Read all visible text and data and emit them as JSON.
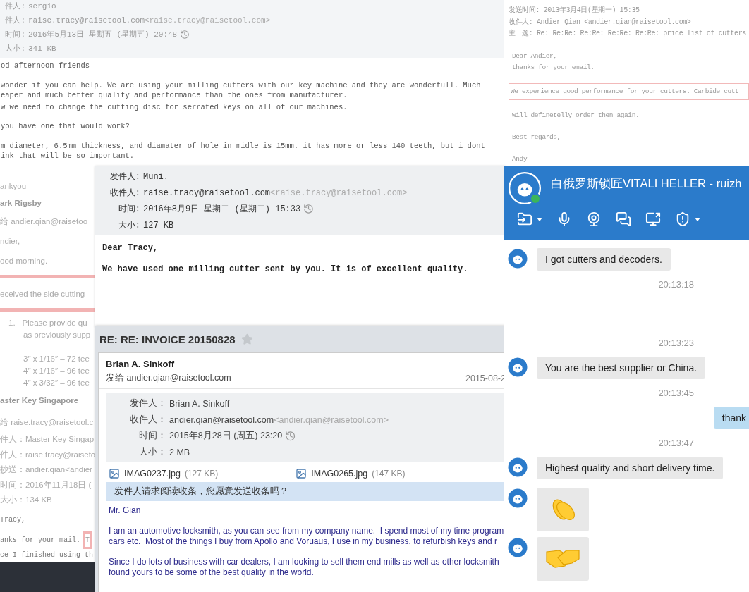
{
  "email_top_left": {
    "header": [
      {
        "label": "件人:",
        "value": "sergio",
        "clock": false
      },
      {
        "label": "件人:",
        "value": "raise.tracy@raisetool.com",
        "note": "<raise.tracy@raisetool.com>",
        "clock": false
      },
      {
        "label": "时间:",
        "value": "2016年5月13日 星期五 (星期五) 20:48",
        "clock": true
      },
      {
        "label": "大小:",
        "value": "341 KB",
        "clock": false
      }
    ],
    "paragraphs": [
      {
        "lines": [
          "od afternoon friends"
        ],
        "highlighted": false
      },
      {
        "lines": [
          "wonder if you can help. We are using your milling cutters with our key machine and they are wonderfull. Much",
          "eaper and much better quality and performance than the ones from manufacturer."
        ],
        "highlighted": true
      },
      {
        "lines": [
          "w we need to change the cutting disc for serrated keys on all of our machines."
        ],
        "highlighted": false
      },
      {
        "lines": [
          "you have one that would work?"
        ],
        "highlighted": false
      },
      {
        "lines": [
          "m diameter, 6.5mm thickness, and diamater of hole in midle is 15mm. it has more or less 140 teeth, but i dont",
          "ink that will be so important."
        ],
        "highlighted": false
      }
    ]
  },
  "left_strip": [
    {
      "kind": "plain",
      "text": "ankyou"
    },
    {
      "kind": "name",
      "text": "ark Rigsby"
    },
    {
      "kind": "plain",
      "text": "给 andier.qian@raisetoo"
    },
    {
      "kind": "plain",
      "text": "ndier,"
    },
    {
      "kind": "plain",
      "text": "ood morning."
    },
    {
      "kind": "bar"
    },
    {
      "kind": "plain",
      "text": "eceived the side cutting"
    },
    {
      "kind": "bar"
    },
    {
      "kind": "numbered",
      "number": "1.",
      "text": "Please provide qu"
    },
    {
      "kind": "indent",
      "text": "as previously supp"
    },
    {
      "kind": "size",
      "text": "3″ x 1/16″ – 72 tee"
    },
    {
      "kind": "size",
      "text": "4″ x 1/16″ – 96 tee"
    },
    {
      "kind": "size",
      "text": "4″ x 3/32″ – 96 tee"
    },
    {
      "kind": "name",
      "text": "aster Key Singapore"
    },
    {
      "kind": "plain",
      "text": "给 raise.tracy@raisetool.c"
    },
    {
      "kind": "meta",
      "text": "件人：Master Key Singap"
    },
    {
      "kind": "meta",
      "text": "件人：raise.tracy@raiseto"
    },
    {
      "kind": "meta",
      "text": "抄送：andier.qian<andier"
    },
    {
      "kind": "meta",
      "text": "时间：2016年11月18日 ("
    },
    {
      "kind": "meta",
      "text": "大小：134 KB"
    },
    {
      "kind": "mono",
      "text": "Tracy,"
    },
    {
      "kind": "mono_boxed",
      "text": "anks for your mail.",
      "boxed": "T"
    },
    {
      "kind": "mono",
      "text": "ce I finished using th"
    }
  ],
  "email_muni": {
    "header": [
      {
        "label": "发件人:",
        "value": "Muni.",
        "clock": false
      },
      {
        "label": "收件人:",
        "value": "raise.tracy@raisetool.com",
        "note": "<raise.tracy@raisetool.com>",
        "clock": false
      },
      {
        "label": "时间:",
        "value": "2016年8月9日 星期二 (星期二) 15:33",
        "clock": true
      },
      {
        "label": "大小:",
        "value": "127 KB",
        "clock": false
      }
    ],
    "body": [
      "Dear Tracy,",
      "We have used one milling cutter sent by you. It is of excellent quality."
    ]
  },
  "email_invoice": {
    "title": "RE: RE: INVOICE 20150828",
    "starred": false,
    "sender": "Brian A. Sinkoff",
    "to": "发给 andier.qian@raisetool.com",
    "date": "2015-08-2",
    "header": [
      {
        "label": "发件人：",
        "value": "Brian A. Sinkoff",
        "clock": false
      },
      {
        "label": "收件人：",
        "value": "andier.qian@raisetool.com",
        "note": "<andier.qian@raisetool.com>",
        "clock": false
      },
      {
        "label": "时间：",
        "value": "2015年8月28日 (周五) 23:20",
        "clock": true
      },
      {
        "label": "大小：",
        "value": "2 MB",
        "clock": false
      }
    ],
    "attachments": [
      {
        "name": "IMAG0237.jpg",
        "size": "(127 KB)"
      },
      {
        "name": "IMAG0265.jpg",
        "size": "(147 KB)"
      }
    ],
    "receipt_notice": "发件人请求阅读收条，您愿意发送收条吗？",
    "greeting": "Mr. Gian",
    "paragraphs": [
      [
        "I am an automotive locksmith, as you can see from my company name.  I spend most of my time program",
        "cars etc.  Most of the things I buy from Apollo and Voruaus, I use in my business, to refurbish keys and r"
      ],
      [
        "Since I do lots of business with car dealers, I am looking to sell them end mills as well as other locksmith",
        "found yours to be some of the best quality in the world."
      ]
    ]
  },
  "email_andy": {
    "header": [
      "发送时间: 2013年3月4日(星期一) 15:35",
      "收件人: Andier Qian <andier.qian@raisetool.com>",
      "主　题: Re: Re:Re: Re:Re: Re:Re: Re:Re: price list of cutters"
    ],
    "paragraphs": [
      {
        "lines": [
          "Dear Andier,",
          "thanks for your email."
        ],
        "highlighted": false
      },
      {
        "lines": [
          "We experience good performance for your cutters. Carbide cutt"
        ],
        "highlighted": true
      },
      {
        "lines": [
          "Will definetelly order then again."
        ],
        "highlighted": false
      },
      {
        "lines": [
          "Best regards,"
        ],
        "highlighted": false
      },
      {
        "lines": [
          "Andy"
        ],
        "highlighted": false
      }
    ]
  },
  "chat": {
    "title": "白俄罗斯锁匠VITALI HELLER - ruizh",
    "online": true,
    "messages": [
      {
        "kind": "in",
        "text": "I got cutters and decoders."
      },
      {
        "kind": "time",
        "text": "20:13:18"
      },
      {
        "kind": "time",
        "text": "20:13:23"
      },
      {
        "kind": "in",
        "text": "You are the best supplier or China."
      },
      {
        "kind": "time",
        "text": "20:13:45"
      },
      {
        "kind": "out",
        "text": "thank"
      },
      {
        "kind": "time",
        "text": "20:13:47"
      },
      {
        "kind": "in",
        "text": "Highest quality and short delivery time."
      },
      {
        "kind": "sticker"
      },
      {
        "kind": "sticker"
      }
    ]
  }
}
